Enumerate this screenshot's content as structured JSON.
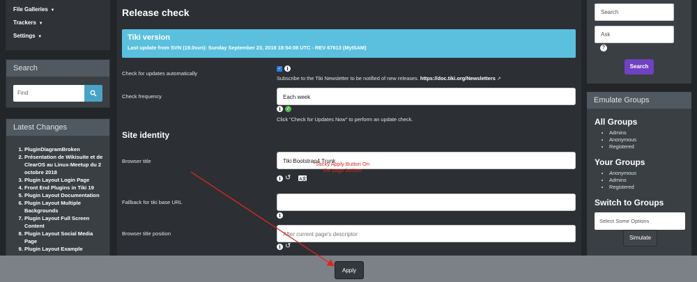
{
  "left_menu": {
    "items": [
      {
        "label": "File Galleries"
      },
      {
        "label": "Trackers"
      },
      {
        "label": "Settings"
      }
    ]
  },
  "search_panel": {
    "title": "Search",
    "placeholder": "Find"
  },
  "latest_changes": {
    "title": "Latest Changes",
    "items": [
      "PluginDiagramBroken",
      "Présentation de Wikisuite et de ClearOS au Linux-Meetup du 2 octobre 2018",
      "Plugin Layout Login Page",
      "Front End Plugins in Tiki 19",
      "Plugin Layout Documentation",
      "Plugin Layout Multiple Backgrounds",
      "Plugin Layout Full Screen Content",
      "Plugin Layout Social Media Page",
      "Plugin Layout Example"
    ]
  },
  "main": {
    "release_heading": "Release check",
    "tiki_box": {
      "title": "Tiki version",
      "text": "Last update from SVN (19.0svn): Sunday September 23, 2018 18:54:08 UTC - REV 67613 (MyISAM)"
    },
    "check_updates": {
      "label": "Check for updates automatically",
      "checked": true,
      "note_prefix": "Subscribe to the Tiki Newsletter to be notified of new releases.",
      "note_link": "https://doc.tiki.org/Newsletters"
    },
    "check_frequency": {
      "label": "Check frequency",
      "value": "Each week",
      "hint": "Click \"Check for Updates Now\" to perform an update check."
    },
    "site_heading": "Site identity",
    "browser_title": {
      "label": "Browser title",
      "value": "Tiki Bootstrap4 Trunk"
    },
    "fallback_url": {
      "label": "Fallback for tiki base URL",
      "value": ""
    },
    "title_position": {
      "label": "Browser title position",
      "placeholder": "After current page's descriptor"
    },
    "annotation": "Sticky Apply Button On the page bottom",
    "apply_label": "Apply"
  },
  "right": {
    "search_placeholder": "Search",
    "ask_placeholder": "Ask",
    "search_button": "Search",
    "emulate": {
      "title": "Emulate Groups",
      "all_groups_heading": "All Groups",
      "all_groups": [
        "Admins",
        "Anonymous",
        "Registered"
      ],
      "your_groups_heading": "Your Groups",
      "your_groups": [
        "Anonymous",
        "Admins",
        "Registered"
      ],
      "switch_heading": "Switch to Groups",
      "select_placeholder": "Select Some Options",
      "simulate_button": "Simulate"
    }
  },
  "colors": {
    "info_box": "#5bc0de",
    "search_button": "#6f42c1",
    "annotation": "#e0251c"
  }
}
